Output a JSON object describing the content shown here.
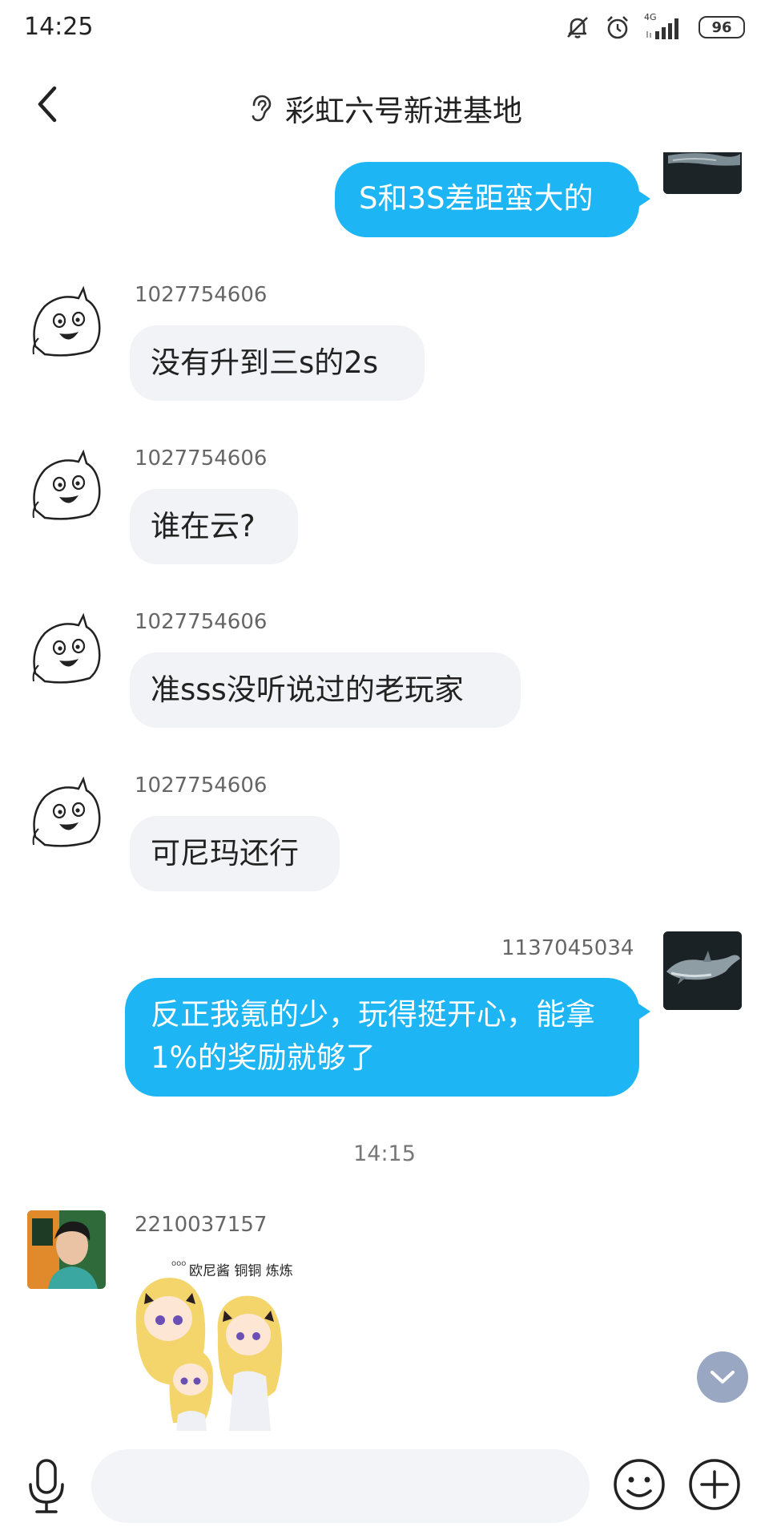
{
  "status_bar": {
    "time": "14:25",
    "network": "4G",
    "battery": "96",
    "icons": [
      "mute-icon",
      "alarm-icon",
      "signal-icon",
      "battery-icon"
    ]
  },
  "header": {
    "title": "彩虹六号新进基地",
    "back_icon": "chevron-left-icon",
    "mode_icon": "ear-icon"
  },
  "messages": [
    {
      "direction": "out",
      "sender": "",
      "text": "S和3S差距蛮大的"
    },
    {
      "direction": "in",
      "sender": "1027754606",
      "text": "没有升到三s的2s"
    },
    {
      "direction": "in",
      "sender": "1027754606",
      "text": "谁在云?"
    },
    {
      "direction": "in",
      "sender": "1027754606",
      "text": "准sss没听说过的老玩家"
    },
    {
      "direction": "in",
      "sender": "1027754606",
      "text": "可尼玛还行"
    },
    {
      "direction": "out",
      "sender": "1137045034",
      "text": "反正我氪的少，玩得挺开心，能拿1%的奖励就够了"
    },
    {
      "direction": "in",
      "sender": "2210037157",
      "type": "sticker",
      "caption": "欧尼酱 铜铜 炼炼"
    }
  ],
  "timestamp": "14:15",
  "input": {
    "placeholder": ""
  },
  "colors": {
    "outgoing_bubble": "#1eb5f5",
    "incoming_bubble": "#f2f3f7",
    "scroll_button": "#9aa7c2"
  }
}
